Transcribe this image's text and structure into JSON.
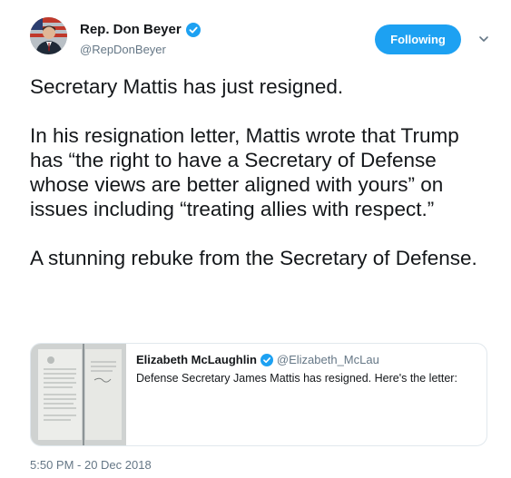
{
  "author": {
    "display_name": "Rep. Don Beyer",
    "handle": "@RepDonBeyer",
    "verified": true
  },
  "follow_button": {
    "label": "Following",
    "color": "#1da1f2"
  },
  "tweet": {
    "text": "Secretary Mattis has just resigned.\n\nIn his resignation letter, Mattis wrote that Trump has “the right to have a Secretary of Defense whose views are better aligned with yours” on issues including “treating allies with respect.”\n\nA stunning rebuke from the Secretary of Defense.",
    "timestamp": "5:50 PM - 20 Dec 2018"
  },
  "quoted_tweet": {
    "display_name": "Elizabeth McLaughlin",
    "handle": "@Elizabeth_McLau",
    "verified": true,
    "text": "Defense Secretary James Mattis has resigned. Here's the letter:"
  },
  "colors": {
    "text": "#14171a",
    "secondary": "#657786",
    "border": "#e1e8ed",
    "accent": "#1da1f2"
  }
}
